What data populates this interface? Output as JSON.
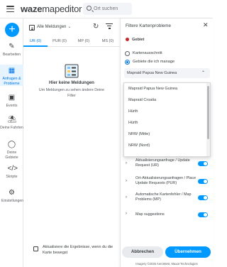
{
  "app": {
    "logo_word": "waze",
    "logo_rest": "mapeditor",
    "search_placeholder": "Ort suchen"
  },
  "sidebar": {
    "add_label": "+",
    "items": [
      {
        "label": "Bearbeiten",
        "icon": "edit-icon"
      },
      {
        "label": "Anfragen & Probleme",
        "icon": "requests-icon"
      },
      {
        "label": "Events",
        "icon": "calendar-icon"
      },
      {
        "label": "Deine Fahrten",
        "icon": "car-icon"
      },
      {
        "label": "Deine Gebiete",
        "icon": "globe-icon"
      },
      {
        "label": "Skripte",
        "icon": "code-icon"
      },
      {
        "label": "Einstellungen",
        "icon": "gear-icon"
      }
    ]
  },
  "problems_panel": {
    "filter_label": "Alle Meldungen",
    "tabs": [
      {
        "label": "UR (0)"
      },
      {
        "label": "PUR (0)"
      },
      {
        "label": "MP (0)"
      },
      {
        "label": "MS (0)"
      }
    ],
    "empty_title": "Hier keine Meldungen",
    "empty_subtitle": "Um Meldungen zu sehen ändere Deine Filter",
    "refresh_checkbox_label": "Aktualisiere die Ergebnisse, wenn du die Karte bewegst",
    "refresh_checked": false
  },
  "filter_panel": {
    "title": "Filtere Kartenprobleme",
    "section_label": "Gebiet",
    "radio_map_area": "Kartenausschnitt",
    "radio_managed_area": "Gebiete die ich manage",
    "selected_area": "Mapraid Papua New Guinea",
    "dropdown_options": [
      "Mapraid Papua New Guinea",
      "Mapraid Croatia",
      "Hürth",
      "Hürth",
      "NRW (Mitte)",
      "NRW (Nord)"
    ],
    "toggles": [
      {
        "label": "Aktualisierungsanfrage / Update Request (UR)",
        "on": true
      },
      {
        "label": "Ort-Aktualisierungsanfragen / Place Update Requests (PUR)",
        "on": true
      },
      {
        "label": "Automatische Kartenfehler / Map Problems (MP)",
        "on": true
      },
      {
        "label": "Map suggestions",
        "on": true
      }
    ],
    "cancel_label": "Abbrechen",
    "apply_label": "Übernehmen",
    "attribution": "Imagery ©2025 AeroWest, Maxar Technologies"
  },
  "colors": {
    "accent": "#0099ff",
    "accent_text": "#0075e3",
    "area_dot": "#c62828"
  }
}
